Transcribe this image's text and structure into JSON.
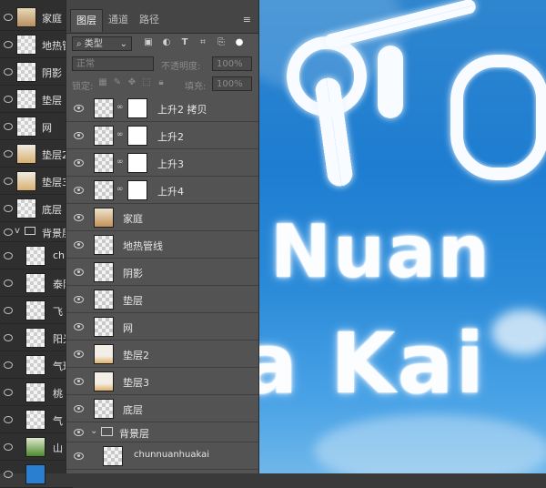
{
  "panel": {
    "tabs": [
      "图层",
      "通道",
      "路径"
    ],
    "active_tab": 0,
    "menu_icon": "menu-icon",
    "filter_type": "类型",
    "blend_mode": "正常",
    "opacity_label": "不透明度:",
    "opacity_value": "100%",
    "lock_label": "锁定:",
    "fill_label": "填充:",
    "fill_value": "100%"
  },
  "layers": [
    {
      "name": "上升2 拷贝",
      "type": "masked"
    },
    {
      "name": "上升2",
      "type": "masked"
    },
    {
      "name": "上升3",
      "type": "masked"
    },
    {
      "name": "上升4",
      "type": "masked"
    },
    {
      "name": "家庭",
      "type": "image"
    },
    {
      "name": "地热管线",
      "type": "plain"
    },
    {
      "name": "阴影",
      "type": "plain"
    },
    {
      "name": "垫层",
      "type": "plain"
    },
    {
      "name": "网",
      "type": "plain"
    },
    {
      "name": "垫层2",
      "type": "image"
    },
    {
      "name": "垫层3",
      "type": "image"
    },
    {
      "name": "底层",
      "type": "plain"
    },
    {
      "name": "背景层",
      "type": "group"
    },
    {
      "name": "chunnuanhuakai",
      "type": "plain"
    }
  ],
  "back_panel": {
    "rows": [
      "家庭",
      "地热管",
      "阴影",
      "垫层",
      "网",
      "垫层2",
      "垫层3",
      "底层",
      "背景层",
      "chu",
      "泰阳",
      "飞",
      "阳光",
      "气球",
      "桃",
      "气",
      "山",
      ""
    ]
  },
  "canvas": {
    "lines": [
      "Nuan",
      "a Kai"
    ]
  },
  "colors": {
    "panel_bg": "#535353",
    "sky": "#1e7dd1"
  }
}
